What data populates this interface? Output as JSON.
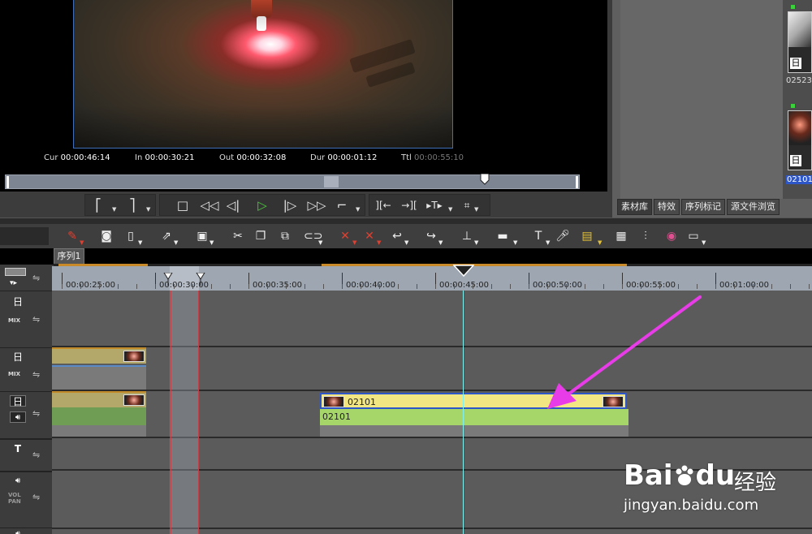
{
  "player": {
    "timecodes": [
      {
        "label": "Cur",
        "value": "00:00:46:14"
      },
      {
        "label": "In",
        "value": "00:00:30:21"
      },
      {
        "label": "Out",
        "value": "00:00:32:08"
      },
      {
        "label": "Dur",
        "value": "00:00:01:12"
      },
      {
        "label": "Ttl",
        "value": "00:00:55:10"
      }
    ]
  },
  "transport": {
    "buttons": [
      {
        "name": "mark-in-icon",
        "glyph": "⎡"
      },
      {
        "name": "mark-out-icon",
        "glyph": "⎤"
      },
      {
        "name": "stop-icon",
        "glyph": "□"
      },
      {
        "name": "rewind-icon",
        "glyph": "◁◁"
      },
      {
        "name": "step-back-icon",
        "glyph": "◁|"
      },
      {
        "name": "play-icon",
        "glyph": "▷"
      },
      {
        "name": "step-forward-icon",
        "glyph": "|▷"
      },
      {
        "name": "fast-forward-icon",
        "glyph": "▷▷"
      },
      {
        "name": "loop-icon",
        "glyph": "⌐"
      },
      {
        "name": "go-to-in-icon",
        "glyph": "][←"
      },
      {
        "name": "go-to-out-icon",
        "glyph": "→]["
      },
      {
        "name": "match-frame-icon",
        "glyph": "▸T▸"
      },
      {
        "name": "export-icon",
        "glyph": "⌗"
      }
    ]
  },
  "bin": {
    "thumbs": [
      {
        "label": "02523",
        "selected": false
      },
      {
        "label": "02101",
        "selected": true
      }
    ],
    "tabs": [
      "素材库",
      "特效",
      "序列标记",
      "源文件浏览"
    ]
  },
  "toolbar": {
    "icons": [
      "timeline-settings-icon",
      "capture-icon",
      "new-icon",
      "open-icon",
      "save-icon",
      "cut-icon",
      "copy-icon",
      "paste-icon",
      "link-icon",
      "delete-icon",
      "ripple-delete-icon",
      "undo-icon",
      "redo-icon",
      "trim-icon",
      "razor-icon",
      "title-icon",
      "voice-over-icon",
      "mixer-icon",
      "grid-icon",
      "audio-mixer-icon",
      "color-icon",
      "monitor-icon"
    ]
  },
  "sequence": {
    "tab": "序列1",
    "ruler_labels": [
      "00:00:25:00",
      "00:00:30:00",
      "00:00:35:00",
      "00:00:40:00",
      "00:00:45:00",
      "00:00:50:00",
      "00:00:55:00",
      "00:01:00:00"
    ]
  },
  "tracks": {
    "mix_label": "MIX",
    "vol_label": "VOL",
    "pan_label": "PAN",
    "title_glyph": "T",
    "video_glyph": "日",
    "selected_clip": {
      "video_name": "02101",
      "audio_name": "02101"
    }
  },
  "watermark": {
    "logo": "Bai",
    "logo2": "du",
    "brand": "经验",
    "url": "jingyan.baidu.com"
  },
  "colors": {
    "accent_blue": "#2d57c8",
    "playhead": "#7ff0f0",
    "arrow": "#e83ce8",
    "play_green": "#4ccc3c"
  }
}
